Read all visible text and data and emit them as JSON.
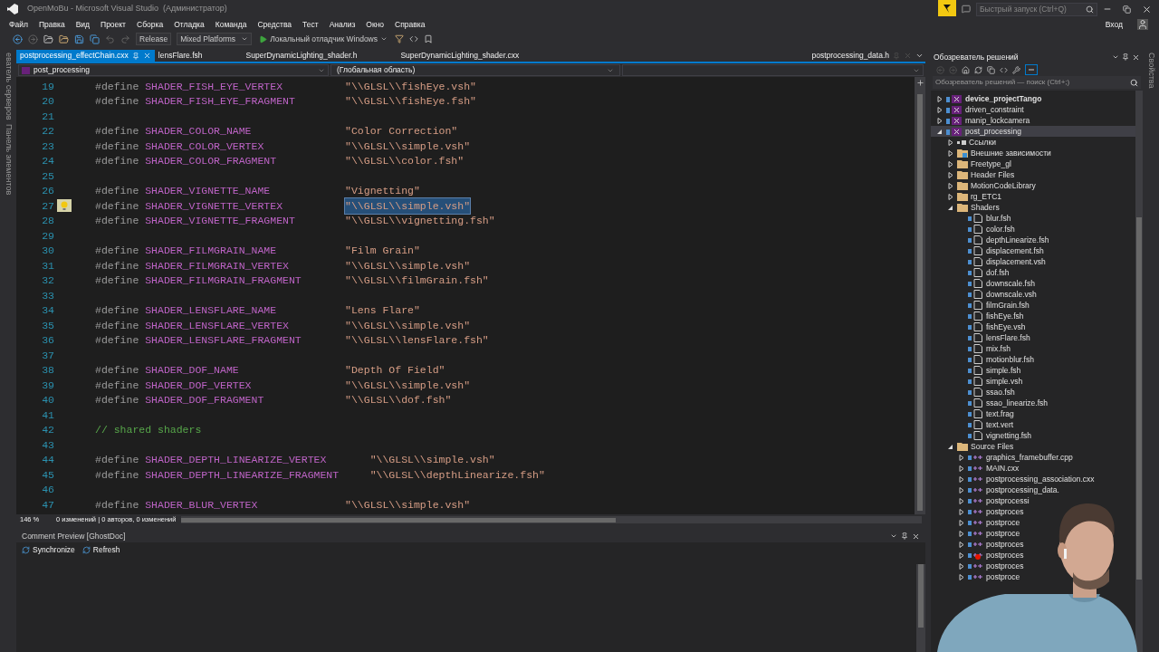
{
  "window": {
    "title": "OpenMoBu - Microsoft Visual Studio  (Администратор)",
    "quick_launch_placeholder": "Быстрый запуск (Ctrl+Q)",
    "sign_in": "Вход"
  },
  "menu": [
    "Файл",
    "Правка",
    "Вид",
    "Проект",
    "Сборка",
    "Отладка",
    "Команда",
    "Средства",
    "Тест",
    "Анализ",
    "Окно",
    "Справка"
  ],
  "toolbar": {
    "configuration": "Release",
    "platform": "Mixed Platforms",
    "debugger": "Локальный отладчик Windows"
  },
  "side_tabs_left": [
    "еватель серверов",
    "Панель элементов"
  ],
  "side_tabs_right": [
    "Свойства"
  ],
  "tabs": [
    {
      "label": "postprocessing_effectChain.cxx",
      "selected": true
    },
    {
      "label": "lensFlare.fsh",
      "selected": false
    },
    {
      "label": "SuperDynamicLighting_shader.h",
      "selected": false
    },
    {
      "label": "SuperDynamicLighting_shader.cxx",
      "selected": false
    }
  ],
  "preview_tab": {
    "label": "postprocessing_data.h"
  },
  "navigation": {
    "project": "post_processing",
    "scope": "(Глобальная область)"
  },
  "code": [
    {
      "n": "19",
      "kind": "define",
      "keyword": "#define",
      "name": "SHADER_FISH_EYE_VERTEX",
      "value": "\"\\\\GLSL\\\\fishEye.vsh\"",
      "selected": false,
      "bulb": false
    },
    {
      "n": "20",
      "kind": "define",
      "keyword": "#define",
      "name": "SHADER_FISH_EYE_FRAGMENT",
      "value": "\"\\\\GLSL\\\\fishEye.fsh\"",
      "selected": false,
      "bulb": false
    },
    {
      "n": "21",
      "kind": "blank"
    },
    {
      "n": "22",
      "kind": "define",
      "keyword": "#define",
      "name": "SHADER_COLOR_NAME",
      "value": "\"Color Correction\"",
      "selected": false,
      "bulb": false
    },
    {
      "n": "23",
      "kind": "define",
      "keyword": "#define",
      "name": "SHADER_COLOR_VERTEX",
      "value": "\"\\\\GLSL\\\\simple.vsh\"",
      "selected": false,
      "bulb": false
    },
    {
      "n": "24",
      "kind": "define",
      "keyword": "#define",
      "name": "SHADER_COLOR_FRAGMENT",
      "value": "\"\\\\GLSL\\\\color.fsh\"",
      "selected": false,
      "bulb": false
    },
    {
      "n": "25",
      "kind": "blank"
    },
    {
      "n": "26",
      "kind": "define",
      "keyword": "#define",
      "name": "SHADER_VIGNETTE_NAME",
      "value": "\"Vignetting\"",
      "selected": false,
      "bulb": false
    },
    {
      "n": "27",
      "kind": "define",
      "keyword": "#define",
      "name": "SHADER_VIGNETTE_VERTEX",
      "value": "\"\\\\GLSL\\\\simple.vsh\"",
      "selected": true,
      "bulb": true
    },
    {
      "n": "28",
      "kind": "define",
      "keyword": "#define",
      "name": "SHADER_VIGNETTE_FRAGMENT",
      "value": "\"\\\\GLSL\\\\vignetting.fsh\"",
      "selected": false,
      "bulb": false
    },
    {
      "n": "29",
      "kind": "blank"
    },
    {
      "n": "30",
      "kind": "define",
      "keyword": "#define",
      "name": "SHADER_FILMGRAIN_NAME",
      "value": "\"Film Grain\"",
      "selected": false,
      "bulb": false
    },
    {
      "n": "31",
      "kind": "define",
      "keyword": "#define",
      "name": "SHADER_FILMGRAIN_VERTEX",
      "value": "\"\\\\GLSL\\\\simple.vsh\"",
      "selected": false,
      "bulb": false
    },
    {
      "n": "32",
      "kind": "define",
      "keyword": "#define",
      "name": "SHADER_FILMGRAIN_FRAGMENT",
      "value": "\"\\\\GLSL\\\\filmGrain.fsh\"",
      "selected": false,
      "bulb": false
    },
    {
      "n": "33",
      "kind": "blank"
    },
    {
      "n": "34",
      "kind": "define",
      "keyword": "#define",
      "name": "SHADER_LENSFLARE_NAME",
      "value": "\"Lens Flare\"",
      "selected": false,
      "bulb": false
    },
    {
      "n": "35",
      "kind": "define",
      "keyword": "#define",
      "name": "SHADER_LENSFLARE_VERTEX",
      "value": "\"\\\\GLSL\\\\simple.vsh\"",
      "selected": false,
      "bulb": false
    },
    {
      "n": "36",
      "kind": "define",
      "keyword": "#define",
      "name": "SHADER_LENSFLARE_FRAGMENT",
      "value": "\"\\\\GLSL\\\\lensFlare.fsh\"",
      "selected": false,
      "bulb": false
    },
    {
      "n": "37",
      "kind": "blank"
    },
    {
      "n": "38",
      "kind": "define",
      "keyword": "#define",
      "name": "SHADER_DOF_NAME",
      "value": "\"Depth Of Field\"",
      "selected": false,
      "bulb": false
    },
    {
      "n": "39",
      "kind": "define",
      "keyword": "#define",
      "name": "SHADER_DOF_VERTEX",
      "value": "\"\\\\GLSL\\\\simple.vsh\"",
      "selected": false,
      "bulb": false
    },
    {
      "n": "40",
      "kind": "define",
      "keyword": "#define",
      "name": "SHADER_DOF_FRAGMENT",
      "value": "\"\\\\GLSL\\\\dof.fsh\"",
      "selected": false,
      "bulb": false
    },
    {
      "n": "41",
      "kind": "blank"
    },
    {
      "n": "42",
      "kind": "comment",
      "text": "// shared shaders"
    },
    {
      "n": "43",
      "kind": "blank"
    },
    {
      "n": "44",
      "kind": "define",
      "keyword": "#define",
      "name": "SHADER_DEPTH_LINEARIZE_VERTEX",
      "value": "\"\\\\GLSL\\\\simple.vsh\"",
      "selected": false,
      "bulb": false
    },
    {
      "n": "45",
      "kind": "define",
      "keyword": "#define",
      "name": "SHADER_DEPTH_LINEARIZE_FRAGMENT",
      "value": "\"\\\\GLSL\\\\depthLinearize.fsh\"",
      "selected": false,
      "bulb": false
    },
    {
      "n": "46",
      "kind": "blank"
    },
    {
      "n": "47",
      "kind": "define",
      "keyword": "#define",
      "name": "SHADER_BLUR_VERTEX",
      "value": "\"\\\\GLSL\\\\simple.vsh\"",
      "selected": false,
      "bulb": false
    }
  ],
  "editor_status": {
    "zoom": "146 %",
    "changes": "0 изменений | 0 авторов, 0 изменений"
  },
  "comment_preview": {
    "title": "Comment Preview [GhostDoc]",
    "buttons": [
      "Synchronize",
      "Refresh"
    ]
  },
  "solution_explorer": {
    "title": "Обозреватель решений",
    "search_placeholder": "Обозреватель решений — поиск (Ctrl+;)",
    "tree": [
      {
        "label": "device_projectTango",
        "kind": "project",
        "expanded": false,
        "selected": false,
        "bold": true
      },
      {
        "label": "driven_constraint",
        "kind": "project",
        "expanded": false,
        "selected": false,
        "bold": false
      },
      {
        "label": "manip_lockcamera",
        "kind": "project",
        "expanded": false,
        "selected": false,
        "bold": false
      },
      {
        "label": "post_processing",
        "kind": "project",
        "expanded": true,
        "selected": true,
        "bold": false,
        "children": [
          {
            "label": "Ссылки",
            "kind": "references",
            "expanded": false,
            "selected": false
          },
          {
            "label": "Внешние зависимости",
            "kind": "external",
            "expanded": false,
            "selected": false
          },
          {
            "label": "Freetype_gl",
            "kind": "folder",
            "expanded": false,
            "selected": false
          },
          {
            "label": "Header Files",
            "kind": "folder",
            "expanded": false,
            "selected": false
          },
          {
            "label": "MotionCodeLibrary",
            "kind": "folder",
            "expanded": false,
            "selected": false
          },
          {
            "label": "rg_ETC1",
            "kind": "folder",
            "expanded": false,
            "selected": false
          },
          {
            "label": "Shaders",
            "kind": "folder",
            "expanded": true,
            "selected": false,
            "children": [
              {
                "label": "blur.fsh",
                "kind": "file",
                "selected": false
              },
              {
                "label": "color.fsh",
                "kind": "file",
                "selected": false
              },
              {
                "label": "depthLinearize.fsh",
                "kind": "file",
                "selected": false
              },
              {
                "label": "displacement.fsh",
                "kind": "file",
                "selected": false
              },
              {
                "label": "displacement.vsh",
                "kind": "file",
                "selected": false
              },
              {
                "label": "dof.fsh",
                "kind": "file",
                "selected": false
              },
              {
                "label": "downscale.fsh",
                "kind": "file",
                "selected": false
              },
              {
                "label": "downscale.vsh",
                "kind": "file",
                "selected": false
              },
              {
                "label": "filmGrain.fsh",
                "kind": "file",
                "selected": false
              },
              {
                "label": "fishEye.fsh",
                "kind": "file",
                "selected": false
              },
              {
                "label": "fishEye.vsh",
                "kind": "file",
                "selected": false
              },
              {
                "label": "lensFlare.fsh",
                "kind": "file",
                "selected": false
              },
              {
                "label": "mix.fsh",
                "kind": "file",
                "selected": false
              },
              {
                "label": "motionblur.fsh",
                "kind": "file",
                "selected": false
              },
              {
                "label": "simple.fsh",
                "kind": "file",
                "selected": false
              },
              {
                "label": "simple.vsh",
                "kind": "file",
                "selected": false
              },
              {
                "label": "ssao.fsh",
                "kind": "file",
                "selected": false
              },
              {
                "label": "ssao_linearize.fsh",
                "kind": "file",
                "selected": false
              },
              {
                "label": "text.frag",
                "kind": "file",
                "selected": false
              },
              {
                "label": "text.vert",
                "kind": "file",
                "selected": false
              },
              {
                "label": "vignetting.fsh",
                "kind": "file",
                "selected": false
              }
            ]
          },
          {
            "label": "Source Files",
            "kind": "folder",
            "expanded": true,
            "selected": false,
            "children": [
              {
                "label": "graphics_framebuffer.cpp",
                "kind": "source",
                "expanded": false,
                "selected": false,
                "error": false
              },
              {
                "label": "MAIN.cxx",
                "kind": "source",
                "expanded": false,
                "selected": false,
                "error": false
              },
              {
                "label": "postprocessing_association.cxx",
                "kind": "source",
                "expanded": false,
                "selected": false,
                "error": false
              },
              {
                "label": "postprocessing_data.",
                "kind": "source",
                "expanded": false,
                "selected": false,
                "error": false
              },
              {
                "label": "postprocessi",
                "kind": "source",
                "expanded": false,
                "selected": false,
                "error": false
              },
              {
                "label": "postproces",
                "kind": "source",
                "expanded": false,
                "selected": false,
                "error": false
              },
              {
                "label": "postproce",
                "kind": "source",
                "expanded": false,
                "selected": false,
                "error": false
              },
              {
                "label": "postproce",
                "kind": "source",
                "expanded": false,
                "selected": false,
                "error": false
              },
              {
                "label": "postproces",
                "kind": "source",
                "expanded": false,
                "selected": false,
                "error": false
              },
              {
                "label": "postproces",
                "kind": "source",
                "expanded": false,
                "selected": false,
                "error": true
              },
              {
                "label": "postproces",
                "kind": "source",
                "expanded": false,
                "selected": false,
                "error": false
              },
              {
                "label": "postproce",
                "kind": "source",
                "expanded": false,
                "selected": false,
                "error": false
              }
            ]
          }
        ]
      }
    ]
  },
  "webcam": {
    "kind": "picture"
  }
}
